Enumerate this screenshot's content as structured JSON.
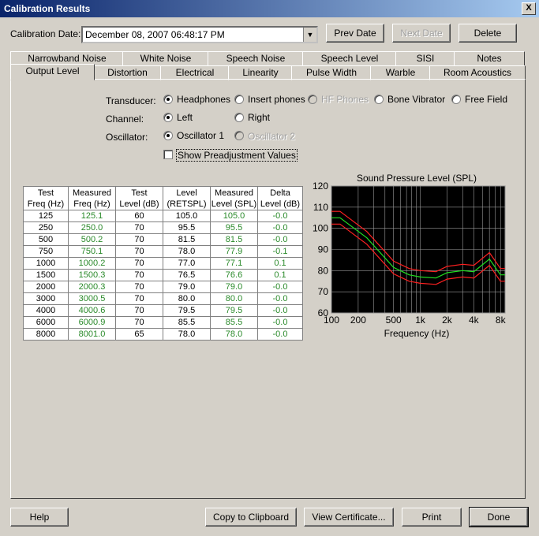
{
  "window": {
    "title": "Calibration Results",
    "close_label": "X"
  },
  "header": {
    "date_label": "Calibration Date:",
    "date_value": "December 08, 2007  06:48:17 PM",
    "prev_date": "Prev Date",
    "next_date": "Next Date",
    "delete": "Delete"
  },
  "tabs_row1": [
    "Narrowband Noise",
    "White Noise",
    "Speech Noise",
    "Speech Level",
    "SISI",
    "Notes"
  ],
  "tabs_row2": [
    "Output Level",
    "Distortion",
    "Electrical",
    "Linearity",
    "Pulse Width",
    "Warble",
    "Room Acoustics"
  ],
  "options": {
    "transducer_label": "Transducer:",
    "channel_label": "Channel:",
    "oscillator_label": "Oscillator:",
    "transducers": [
      "Headphones",
      "Insert phones",
      "HF Phones",
      "Bone Vibrator",
      "Free Field"
    ],
    "channels": [
      "Left",
      "Right"
    ],
    "oscillators": [
      "Oscillator 1",
      "Oscillator 2"
    ],
    "show_preadjust": "Show Preadjustment Values"
  },
  "table": {
    "headers": [
      [
        "Test",
        "Freq (Hz)"
      ],
      [
        "Measured",
        "Freq (Hz)"
      ],
      [
        "Test",
        "Level (dB)"
      ],
      [
        "Level",
        "(RETSPL)"
      ],
      [
        "Measured",
        "Level (SPL)"
      ],
      [
        "Delta",
        "Level (dB)"
      ]
    ],
    "rows": [
      [
        "125",
        "125.1",
        "60",
        "105.0",
        "105.0",
        "-0.0"
      ],
      [
        "250",
        "250.0",
        "70",
        "95.5",
        "95.5",
        "-0.0"
      ],
      [
        "500",
        "500.2",
        "70",
        "81.5",
        "81.5",
        "-0.0"
      ],
      [
        "750",
        "750.1",
        "70",
        "78.0",
        "77.9",
        "-0.1"
      ],
      [
        "1000",
        "1000.2",
        "70",
        "77.0",
        "77.1",
        "0.1"
      ],
      [
        "1500",
        "1500.3",
        "70",
        "76.5",
        "76.6",
        "0.1"
      ],
      [
        "2000",
        "2000.3",
        "70",
        "79.0",
        "79.0",
        "-0.0"
      ],
      [
        "3000",
        "3000.5",
        "70",
        "80.0",
        "80.0",
        "-0.0"
      ],
      [
        "4000",
        "4000.6",
        "70",
        "79.5",
        "79.5",
        "-0.0"
      ],
      [
        "6000",
        "6000.9",
        "70",
        "85.5",
        "85.5",
        "-0.0"
      ],
      [
        "8000",
        "8001.0",
        "65",
        "78.0",
        "78.0",
        "-0.0"
      ]
    ]
  },
  "chart_data": {
    "type": "line",
    "title": "Sound Pressure Level (SPL)",
    "xlabel": "Frequency (Hz)",
    "ylabel": "",
    "x_scale": "log",
    "xlim": [
      100,
      9000
    ],
    "ylim": [
      60,
      120
    ],
    "x_ticks": [
      100,
      200,
      500,
      1000,
      2000,
      4000,
      8000
    ],
    "x_tick_labels": [
      "100",
      "200",
      "500",
      "1k",
      "2k",
      "4k",
      "8k"
    ],
    "y_ticks": [
      60,
      70,
      80,
      90,
      100,
      110,
      120
    ],
    "grid": true,
    "background": "#000000",
    "x": [
      100,
      125,
      250,
      500,
      750,
      1000,
      1500,
      2000,
      3000,
      4000,
      6000,
      8000,
      9000
    ],
    "series": [
      {
        "color": "#ff2020",
        "values": [
          108.0,
          108.0,
          98.5,
          84.5,
          81.0,
          80.0,
          79.5,
          82.0,
          83.0,
          82.5,
          88.5,
          81.0,
          81.0
        ]
      },
      {
        "color": "#20e020",
        "values": [
          105.0,
          105.0,
          95.5,
          81.5,
          78.0,
          77.0,
          76.5,
          79.0,
          80.0,
          79.5,
          85.5,
          78.0,
          78.0
        ]
      },
      {
        "color": "#ff2020",
        "values": [
          102.0,
          102.0,
          92.5,
          78.5,
          75.0,
          74.0,
          73.5,
          76.0,
          77.0,
          76.5,
          82.5,
          75.0,
          75.0
        ]
      }
    ]
  },
  "footer": {
    "help": "Help",
    "copy": "Copy to Clipboard",
    "certificate": "View Certificate...",
    "print": "Print",
    "done": "Done"
  }
}
